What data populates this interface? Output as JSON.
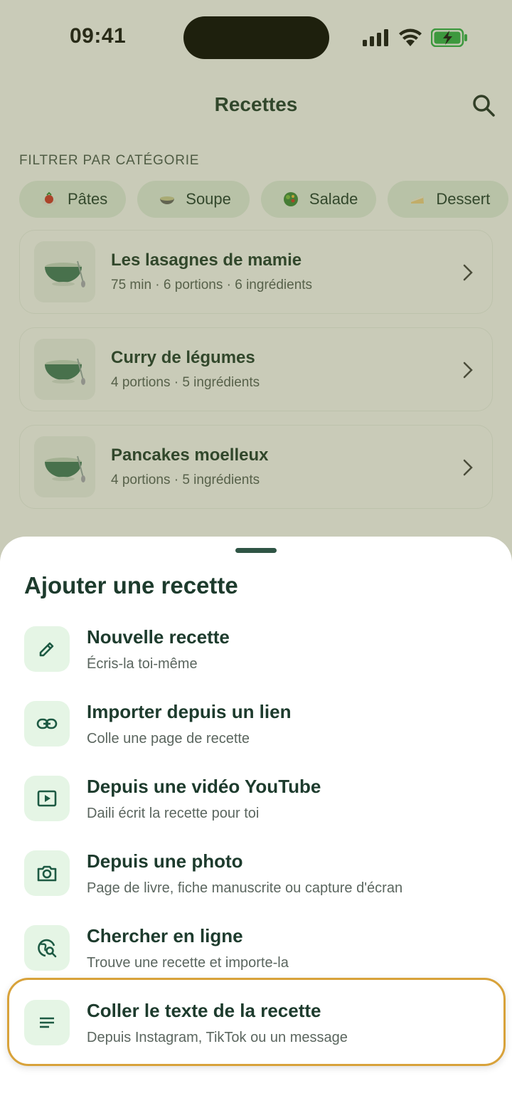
{
  "status_bar": {
    "time": "09:41",
    "icons": [
      "signal-icon",
      "wifi-icon",
      "battery-charging-icon"
    ]
  },
  "header": {
    "title": "Recettes",
    "search_icon": "search-icon"
  },
  "filter": {
    "label": "FILTRER PAR CATÉGORIE",
    "chips": [
      {
        "label": "Pâtes",
        "icon": "pasta-icon"
      },
      {
        "label": "Soupe",
        "icon": "soup-icon"
      },
      {
        "label": "Salade",
        "icon": "salad-icon"
      },
      {
        "label": "Dessert",
        "icon": "cake-icon"
      }
    ]
  },
  "recipes": [
    {
      "title": "Les lasagnes de mamie",
      "meta": "75 min · 6 portions · 6 ingrédients"
    },
    {
      "title": "Curry de légumes",
      "meta": "4 portions · 5 ingrédients"
    },
    {
      "title": "Pancakes moelleux",
      "meta": "4 portions · 5 ingrédients"
    }
  ],
  "sheet": {
    "title": "Ajouter une recette",
    "options": [
      {
        "title": "Nouvelle recette",
        "subtitle": "Écris-la toi-même",
        "icon": "pencil-icon"
      },
      {
        "title": "Importer depuis un lien",
        "subtitle": "Colle une page de recette",
        "icon": "link-icon"
      },
      {
        "title": "Depuis une vidéo YouTube",
        "subtitle": "Daili écrit la recette pour toi",
        "icon": "video-play-icon"
      },
      {
        "title": "Depuis une photo",
        "subtitle": "Page de livre, fiche manuscrite ou capture d'écran",
        "icon": "camera-icon"
      },
      {
        "title": "Chercher en ligne",
        "subtitle": "Trouve une recette et importe-la",
        "icon": "globe-search-icon"
      },
      {
        "title": "Coller le texte de la recette",
        "subtitle": "Depuis Instagram, TikTok ou un message",
        "icon": "text-lines-icon"
      }
    ]
  },
  "colors": {
    "accent": "#1d5a43",
    "icon_bg": "#e5f5e5",
    "highlight": "#d8a23a",
    "scrim": "#5c6028"
  }
}
